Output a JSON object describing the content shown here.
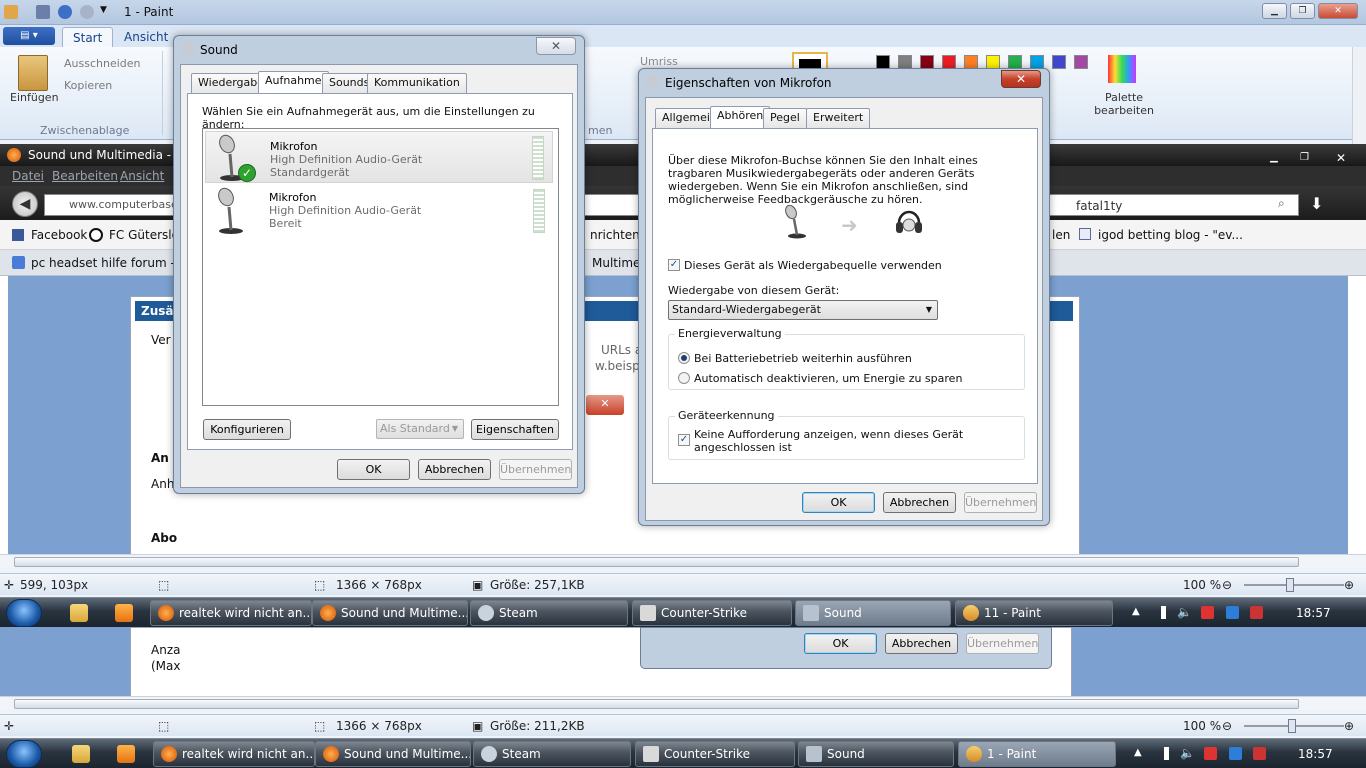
{
  "paint": {
    "title": "1 - Paint",
    "tabs": [
      "Start",
      "Ansicht"
    ],
    "clipboard": {
      "paste": "Einfügen",
      "cut": "Ausschneiden",
      "copy": "Kopieren",
      "group": "Zwischenablage"
    },
    "outline": "Umriss",
    "shapes_fragment": "men",
    "palette": "Palette bearbeiten",
    "colors": [
      "#000000",
      "#7f7f7f",
      "#880015",
      "#ed1c24",
      "#ff7f27",
      "#fff200",
      "#22b14c",
      "#00a2e8",
      "#3f48cc",
      "#a349a4"
    ]
  },
  "browser": {
    "title": "Sound und Multimedia - N",
    "menu": [
      "Datei",
      "Bearbeiten",
      "Ansicht"
    ],
    "url": "www.computerbase",
    "search": "fatal1ty",
    "bookmarks": [
      "Facebook",
      "FC Gütersloh",
      "nrichten",
      "len",
      "igod betting blog - \"ev..."
    ],
    "tab": "pc headset hilfe forum - Go",
    "tab_fragment": "Multime",
    "forum": {
      "bar": "Zusä",
      "line1": "Ver",
      "urls": "URLs a",
      "urls2": "w.beispi",
      "h2": "An",
      "line2": "Anh",
      "h3": "Abo",
      "line3": "Anza",
      "line4": "(Max"
    }
  },
  "sound": {
    "title": "Sound",
    "tabs": [
      "Wiedergabe",
      "Aufnahme",
      "Sounds",
      "Kommunikation"
    ],
    "prompt": "Wählen Sie ein Aufnahmegerät aus, um die Einstellungen zu ändern:",
    "devices": [
      {
        "name": "Mikrofon",
        "type": "High Definition Audio-Gerät",
        "status": "Standardgerät"
      },
      {
        "name": "Mikrofon",
        "type": "High Definition Audio-Gerät",
        "status": "Bereit"
      }
    ],
    "configure": "Konfigurieren",
    "set_default": "Als Standard",
    "properties": "Eigenschaften",
    "ok": "OK",
    "cancel": "Abbrechen",
    "apply": "Übernehmen"
  },
  "mic_props": {
    "title": "Eigenschaften von Mikrofon",
    "tabs": [
      "Allgemein",
      "Abhören",
      "Pegel",
      "Erweitert"
    ],
    "description": "Über diese Mikrofon-Buchse können Sie den Inhalt eines tragbaren Musikwiedergabegeräts oder anderen Geräts wiedergeben. Wenn Sie ein Mikrofon anschließen, sind möglicherweise Feedbackgeräusche zu hören.",
    "listen_checkbox": "Dieses Gerät als Wiedergabequelle verwenden",
    "playback_label": "Wiedergabe von diesem Gerät:",
    "playback_value": "Standard-Wiedergabegerät",
    "power_group": "Energieverwaltung",
    "power_opt1": "Bei Batteriebetrieb weiterhin ausführen",
    "power_opt2": "Automatisch deaktivieren, um Energie zu sparen",
    "detect_group": "Geräteerkennung",
    "detect_checkbox": "Keine Aufforderung anzeigen, wenn dieses Gerät angeschlossen ist",
    "ok": "OK",
    "cancel": "Abbrechen",
    "apply": "Übernehmen"
  },
  "status1": {
    "pos": "599, 103px",
    "dims": "1366 × 768px",
    "size": "Größe: 257,1KB",
    "zoom": "100 %"
  },
  "status2": {
    "dims": "1366 × 768px",
    "size": "Größe: 211,2KB",
    "zoom": "100 %"
  },
  "taskbar1": {
    "buttons": [
      "realtek wird nicht an...",
      "Sound und Multime...",
      "Steam",
      "Counter-Strike",
      "Sound",
      "11 - Paint"
    ],
    "time": "18:57"
  },
  "taskbar2": {
    "buttons": [
      "realtek wird nicht an...",
      "Sound und Multime...",
      "Steam",
      "Counter-Strike",
      "Sound",
      "1 - Paint"
    ],
    "time": "18:57"
  },
  "ghost": {
    "ok": "OK",
    "cancel": "Abbrechen",
    "apply": "Übernehmen"
  }
}
